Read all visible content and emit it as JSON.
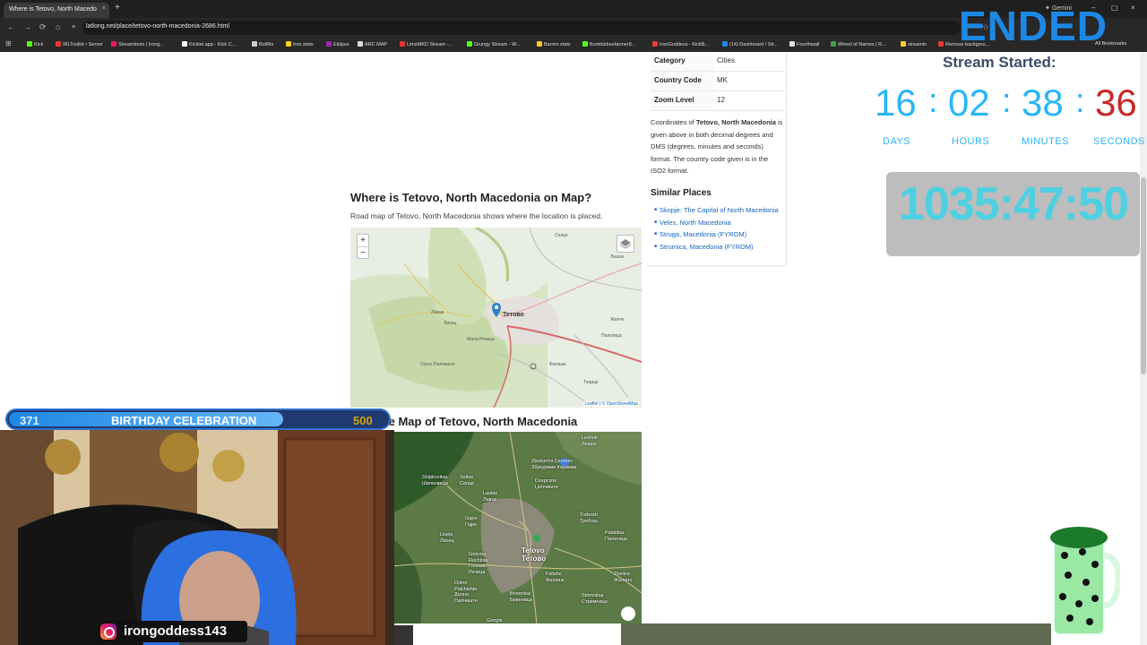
{
  "browser": {
    "tab_title": "Where is Tetovo, North Macedo",
    "tab_close": "×",
    "new_tab": "+",
    "gemini": "Gemini",
    "url": "latlong.net/place/tetovo-north-macedonia-2686.html",
    "window_minimize": "–",
    "window_maximize": "▢",
    "window_close": "×"
  },
  "bookmarks": [
    {
      "label": "Kick",
      "color": "#53fc18"
    },
    {
      "label": "IRLToolkit • Server",
      "color": "#e53935"
    },
    {
      "label": "Streamloots | Irong...",
      "color": "#e91e63"
    },
    {
      "label": "Kicklet.app - Kick C...",
      "color": "#ffffff"
    },
    {
      "label": "BotRix",
      "color": "#cccccc"
    },
    {
      "label": "Iron stats",
      "color": "#ffca28"
    },
    {
      "label": "Eklipse",
      "color": "#9c27b0"
    },
    {
      "label": "ARC MAP",
      "color": "#dddddd"
    },
    {
      "label": "LimsMKD Stream -...",
      "color": "#e53935"
    },
    {
      "label": "Grungy Stream - W...",
      "color": "#53fc18"
    },
    {
      "label": "Barren stats",
      "color": "#ffca28"
    },
    {
      "label": "Bumblebeefarmer8...",
      "color": "#53fc18"
    },
    {
      "label": "IronGoddess - KickB...",
      "color": "#e53935"
    },
    {
      "label": "(14) Dashboard / Str...",
      "color": "#1e88e5"
    },
    {
      "label": "Fourthwall",
      "color": "#dddddd"
    },
    {
      "label": "Wheel of Names | R...",
      "color": "#43a047"
    },
    {
      "label": "streamin",
      "color": "#ffca28"
    },
    {
      "label": "Remove backgrou...",
      "color": "#e53935"
    }
  ],
  "all_bookmarks": "All Bookmarks",
  "overlay_ended": "ENDED",
  "info_table": [
    {
      "key": "Category",
      "value": "Cities"
    },
    {
      "key": "Country Code",
      "value": "MK"
    },
    {
      "key": "Zoom Level",
      "value": "12"
    }
  ],
  "coords_text": {
    "prefix": "Coordinates of ",
    "place": "Tetovo, North Macedonia",
    "suffix": " is given above in both decimal degrees and DMS (degrees, minutes and seconds) format. The country code given is in the ISO2 format."
  },
  "similar_places": {
    "heading": "Similar Places",
    "items": [
      "Skopje: The Capital of North Macedonia",
      "Veles, North Macedonia",
      "Struga, Macedonia (FYROM)",
      "Strumica, Macedonia (FYROM)"
    ]
  },
  "map_section": {
    "title": "Where is Tetovo, North Macedonia on Map?",
    "subtitle": "Road map of Tetovo, North Macedonia shows where the location is placed.",
    "zoom_in": "+",
    "zoom_out": "−",
    "attribution": "Leaflet | © OpenStreetMap",
    "city_label": "Тетово",
    "labels": [
      "Селце",
      "Лавце",
      "Лисец",
      "Мала Речица",
      "Горно Палчиште",
      "Фалише",
      "Теарце",
      "Лешок",
      "Жилче",
      "Палатица"
    ]
  },
  "satellite_section": {
    "title": "Satellite Map of Tetovo, North Macedonia",
    "labels": [
      {
        "t": "Leshok\nЛешок"
      },
      {
        "t": "Zbukurimi Ceramic\nЗбукурими Керамик"
      },
      {
        "t": "Shipkovitsa\nШипковица"
      },
      {
        "t": "Seltse\nСелце"
      },
      {
        "t": "Dzepciste\nЏепчиште"
      },
      {
        "t": "Lavtse\nЛавце"
      },
      {
        "t": "Gajre\nГајре"
      },
      {
        "t": "Tetovo\nТетово"
      },
      {
        "t": "Trebosh\nТребош"
      },
      {
        "t": "Lisets\nЛисец"
      },
      {
        "t": "Palatitsa\nПалатица"
      },
      {
        "t": "Golema\nRechitsa\nГолема\nРечица"
      },
      {
        "t": "Falishe\nФалише"
      },
      {
        "t": "Zhelino\nЖелино"
      },
      {
        "t": "Dolno\nPalchishte\nДолно\nПалчиште"
      },
      {
        "t": "Brvenitsa\nБрвеница"
      },
      {
        "t": "Strimnitsa\nСтримница"
      },
      {
        "t": "Google"
      }
    ]
  },
  "stream_overlay": {
    "started_label": "Stream Started:",
    "countdown": [
      {
        "value": "16",
        "label": "DAYS"
      },
      {
        "value": "02",
        "label": "HOURS"
      },
      {
        "value": "38",
        "label": "MINUTES"
      },
      {
        "value": "36",
        "label": "SECONDS"
      }
    ],
    "separator": ":",
    "timer": "1035:47:50",
    "banner_left": "371",
    "banner_title": "BIRTHDAY CELEBRATION",
    "banner_right": "500",
    "banner_progress": 0.74,
    "instagram": "irongoddess143"
  },
  "colors": {
    "accent_blue": "#29b6f6",
    "seconds_red": "#c62828",
    "ended_blue": "#1e88e5",
    "link_blue": "#1565c0"
  }
}
